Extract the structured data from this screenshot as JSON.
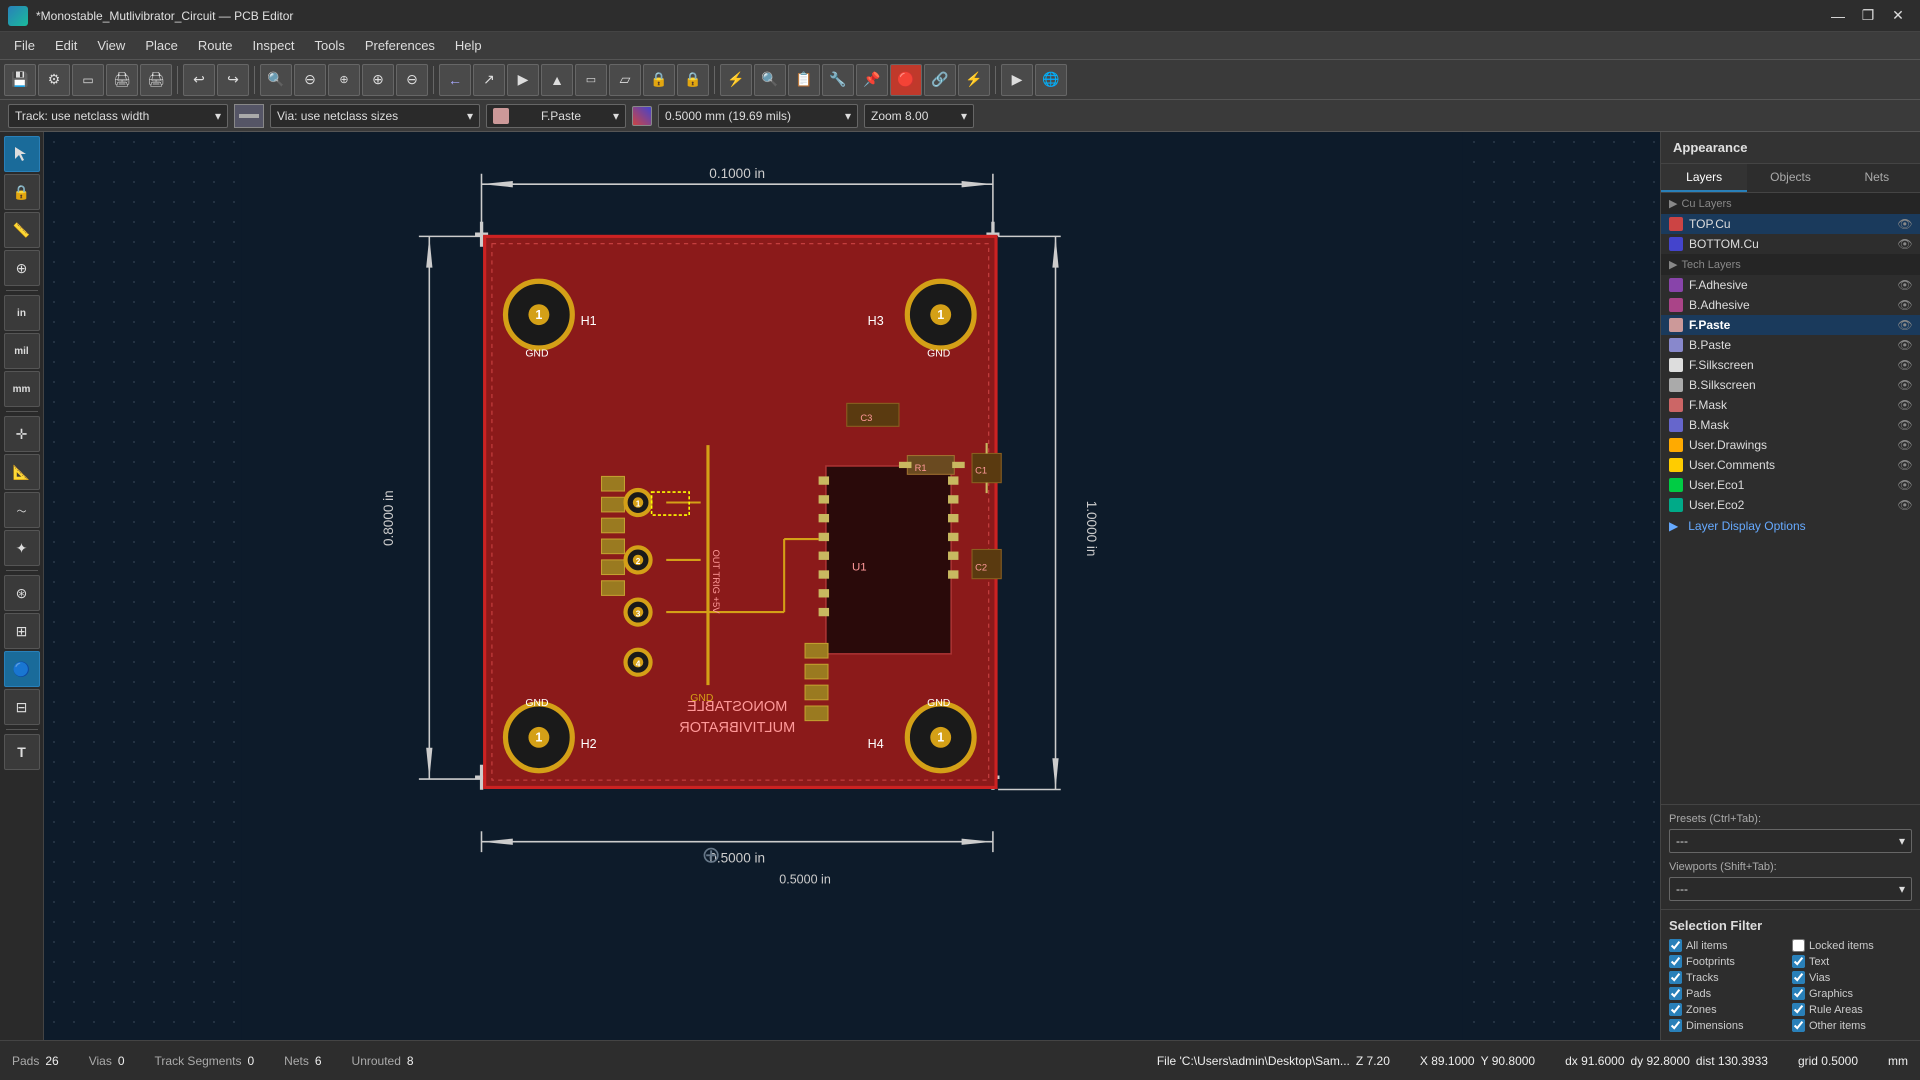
{
  "titlebar": {
    "title": "*Monostable_Mutlivibrator_Circuit — PCB Editor",
    "min_label": "—",
    "max_label": "❐",
    "close_label": "✕"
  },
  "menubar": {
    "items": [
      "File",
      "Edit",
      "View",
      "Place",
      "Route",
      "Inspect",
      "Tools",
      "Preferences",
      "Help"
    ]
  },
  "toolbar": {
    "buttons": [
      "💾",
      "⚙",
      "▭",
      "🖨",
      "🖨",
      "|",
      "↩",
      "↪",
      "|",
      "🔍",
      "⊖",
      "⊕",
      "⊕",
      "⊖",
      "⊕",
      "|",
      "←",
      "↗",
      "►",
      "▲",
      "▭",
      "▱",
      "🔒",
      "🔒",
      "⚡",
      "🔍",
      "📋",
      "🔧",
      "📌",
      "🔴",
      "🔗",
      "⚡",
      "▶",
      "🌐"
    ]
  },
  "toolbar2": {
    "track_label": "Track: use netclass width",
    "via_label": "Via: use netclass sizes",
    "layer": "F.Paste",
    "size": "0.5000 mm (19.69 mils)",
    "zoom": "Zoom 8.00"
  },
  "appearance": {
    "title": "Appearance",
    "tabs": [
      "Layers",
      "Objects",
      "Nets"
    ],
    "active_tab": "Layers",
    "layers": [
      {
        "name": "TOP.Cu",
        "color": "#cc4444",
        "active": true
      },
      {
        "name": "BOTTOM.Cu",
        "color": "#4444cc"
      },
      {
        "name": "F.Adhesive",
        "color": "#8844aa"
      },
      {
        "name": "B.Adhesive",
        "color": "#aa4488"
      },
      {
        "name": "F.Paste",
        "color": "#cc8888",
        "active": true
      },
      {
        "name": "B.Paste",
        "color": "#8888cc"
      },
      {
        "name": "F.Silkscreen",
        "color": "#dddddd"
      },
      {
        "name": "B.Silkscreen",
        "color": "#aaaaaa"
      },
      {
        "name": "F.Mask",
        "color": "#cc6666"
      },
      {
        "name": "B.Mask",
        "color": "#6666cc"
      },
      {
        "name": "User.Drawings",
        "color": "#ffaa00"
      },
      {
        "name": "User.Comments",
        "color": "#ffcc00"
      },
      {
        "name": "User.Eco1",
        "color": "#00cc44"
      },
      {
        "name": "User.Eco2",
        "color": "#00aa88"
      }
    ],
    "layer_display_options": "Layer Display Options",
    "presets_label": "Presets (Ctrl+Tab):",
    "presets_value": "---",
    "viewports_label": "Viewports (Shift+Tab):",
    "viewports_value": "---"
  },
  "selection_filter": {
    "title": "Selection Filter",
    "items": [
      {
        "label": "All items",
        "checked": true
      },
      {
        "label": "Locked items",
        "checked": false
      },
      {
        "label": "Footprints",
        "checked": true
      },
      {
        "label": "Text",
        "checked": true
      },
      {
        "label": "Tracks",
        "checked": true
      },
      {
        "label": "Vias",
        "checked": true
      },
      {
        "label": "Pads",
        "checked": true
      },
      {
        "label": "Graphics",
        "checked": true
      },
      {
        "label": "Zones",
        "checked": true
      },
      {
        "label": "Rule Areas",
        "checked": true
      },
      {
        "label": "Dimensions",
        "checked": true
      },
      {
        "label": "Other items",
        "checked": true
      }
    ]
  },
  "statusbar": {
    "pads_label": "Pads",
    "pads_value": "26",
    "vias_label": "Vias",
    "vias_value": "0",
    "track_label": "Track Segments",
    "track_value": "0",
    "nets_label": "Nets",
    "nets_value": "6",
    "unrouted_label": "Unrouted",
    "unrouted_value": "8",
    "file_path": "File 'C:\\Users\\admin\\Desktop\\Sam...",
    "z_value": "Z 7.20",
    "x_value": "X 89.1000",
    "y_value": "Y 90.8000",
    "dx_value": "dx 91.6000",
    "dy_value": "dy 92.8000",
    "dist_value": "dist 130.3933",
    "grid_value": "grid 0.5000",
    "unit": "mm"
  },
  "left_tools": {
    "buttons": [
      "cursor",
      "lock",
      "measure",
      "origin",
      "unit_in",
      "unit_mil",
      "unit_mm",
      "snap",
      "ruler",
      "route",
      "net",
      "fan",
      "group",
      "ungroup"
    ]
  },
  "pcb": {
    "board_label": "MONOSTABLE\nMULTIVIBRATOR",
    "holes": [
      {
        "id": "H1",
        "gnd": "GND",
        "pos": "top-left"
      },
      {
        "id": "H3",
        "gnd": "GND",
        "pos": "top-right"
      },
      {
        "id": "H2",
        "gnd": "GND",
        "pos": "bottom-left"
      },
      {
        "id": "H4",
        "gnd": "GND",
        "pos": "bottom-right"
      }
    ],
    "dim_top": "0.1000 in",
    "dim_right": "1.0000 in",
    "dim_bottom": "0.5000 in",
    "dim_left": "0.8000 in",
    "components": [
      "R1",
      "C1",
      "C2",
      "C3",
      "U1"
    ]
  }
}
